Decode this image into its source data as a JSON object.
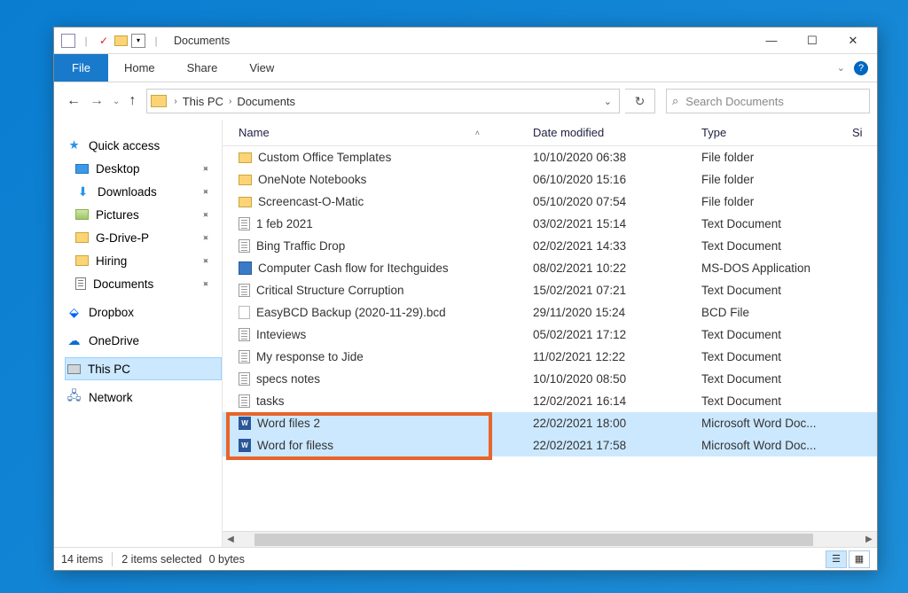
{
  "window": {
    "title": "Documents"
  },
  "ribbon": {
    "file": "File",
    "tabs": [
      "Home",
      "Share",
      "View"
    ]
  },
  "breadcrumb": {
    "parts": [
      "This PC",
      "Documents"
    ]
  },
  "search": {
    "placeholder": "Search Documents"
  },
  "columns": {
    "name": "Name",
    "date": "Date modified",
    "type": "Type",
    "size": "Si"
  },
  "navpane": {
    "quick": "Quick access",
    "items": [
      {
        "label": "Desktop",
        "icon": "desktop",
        "pinned": true
      },
      {
        "label": "Downloads",
        "icon": "down",
        "pinned": true
      },
      {
        "label": "Pictures",
        "icon": "pic",
        "pinned": true
      },
      {
        "label": "G-Drive-P",
        "icon": "folder",
        "pinned": true
      },
      {
        "label": "Hiring",
        "icon": "folder",
        "pinned": true
      },
      {
        "label": "Documents",
        "icon": "doc",
        "pinned": true
      }
    ],
    "dropbox": "Dropbox",
    "onedrive": "OneDrive",
    "thispc": "This PC",
    "network": "Network"
  },
  "files": [
    {
      "name": "Custom Office Templates",
      "date": "10/10/2020 06:38",
      "type": "File folder",
      "ico": "folder"
    },
    {
      "name": "OneNote Notebooks",
      "date": "06/10/2020 15:16",
      "type": "File folder",
      "ico": "folder"
    },
    {
      "name": "Screencast-O-Matic",
      "date": "05/10/2020 07:54",
      "type": "File folder",
      "ico": "folder"
    },
    {
      "name": "1 feb 2021",
      "date": "03/02/2021 15:14",
      "type": "Text Document",
      "ico": "text"
    },
    {
      "name": "Bing Traffic Drop",
      "date": "02/02/2021 14:33",
      "type": "Text Document",
      "ico": "text"
    },
    {
      "name": "Computer Cash flow for Itechguides",
      "date": "08/02/2021 10:22",
      "type": "MS-DOS Application",
      "ico": "app"
    },
    {
      "name": "Critical Structure Corruption",
      "date": "15/02/2021 07:21",
      "type": "Text Document",
      "ico": "text"
    },
    {
      "name": "EasyBCD Backup (2020-11-29).bcd",
      "date": "29/11/2020 15:24",
      "type": "BCD File",
      "ico": "bcd"
    },
    {
      "name": "Inteviews",
      "date": "05/02/2021 17:12",
      "type": "Text Document",
      "ico": "text"
    },
    {
      "name": "My response to Jide",
      "date": "11/02/2021 12:22",
      "type": "Text Document",
      "ico": "text"
    },
    {
      "name": "specs notes",
      "date": "10/10/2020 08:50",
      "type": "Text Document",
      "ico": "text"
    },
    {
      "name": "tasks",
      "date": "12/02/2021 16:14",
      "type": "Text Document",
      "ico": "text"
    },
    {
      "name": "Word files 2",
      "date": "22/02/2021 18:00",
      "type": "Microsoft Word Doc...",
      "ico": "word",
      "selected": true
    },
    {
      "name": "Word for filess",
      "date": "22/02/2021 17:58",
      "type": "Microsoft Word Doc...",
      "ico": "word",
      "selected": true
    }
  ],
  "status": {
    "count": "14 items",
    "selection": "2 items selected",
    "bytes": "0 bytes"
  }
}
